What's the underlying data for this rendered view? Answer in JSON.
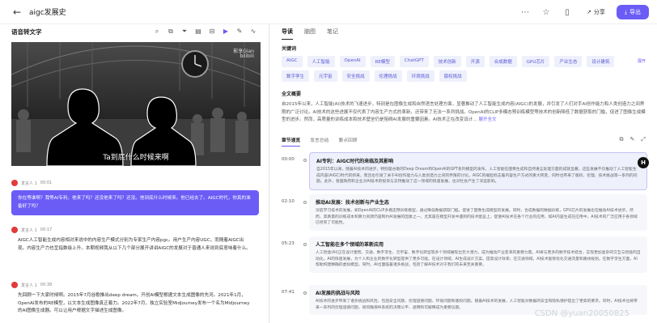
{
  "header": {
    "title": "aigc发展史",
    "share_label": "分享",
    "export_label": "导出"
  },
  "left": {
    "section_label": "语音转文字",
    "tool_icons": [
      "search-icon",
      "copy-icon",
      "filter-icon",
      "doc-icon",
      "collapse-icon",
      "video-icon",
      "edit-icon",
      "waveform-icon"
    ],
    "video": {
      "subtitle": "Ta到底什么时候来啊",
      "watermark_line1": "影享Gian",
      "watermark_line2": "bilibili"
    },
    "messages": [
      {
        "speaker": "发言人 1",
        "time": "00:01",
        "text": "你在等谁啊？我等AI专利。他来了吗？还没他来了吗？还没。他到底什么时候来。他已经去了。AIGC时代，你真的准备好了吗？"
      },
      {
        "speaker": "发言人 1",
        "time": "00:17",
        "text": "AIGC人工智能生成内容相对来说中的内容生产模式分别为专家生产内容pgc。用户生产内容UGC。而随着AIGC出现。内容生产力也呈指数级上升。本期视频我从以下几个部分展开讲讲AIGC的发展对于普通人来说到底意味着什么。"
      },
      {
        "speaker": "发言人 1",
        "time": "00:38",
        "text": "先回顾一下大家时候啊。2015年7月谷歌推出deep dream。开创AI模型根据文本生成图像的先河。2021年1月，OpenAI发布的RE模型，以文本生成图像真正着力。2022年7月，独立实验室Midjourney发布一个名为Midjourney的AI图像生成器。可以让用户根据文字描述生成图像。"
      }
    ]
  },
  "right": {
    "tabs": [
      "导读",
      "脑图",
      "笔记"
    ],
    "keywords_title": "关键词",
    "keywords_more": "展开",
    "keywords": [
      "AIGC",
      "人工智能",
      "OpenAI",
      "RE模型",
      "ChatGPT",
      "技术创新",
      "开源",
      "合成数据",
      "GPU芯片",
      "产业生态",
      "设计建筑",
      "数字孪生",
      "元宇宙",
      "安全挑战",
      "伦理挑战",
      "环境挑战",
      "版权挑战"
    ],
    "summary_title": "全文概要",
    "summary": "自2015年以来，人工智能(AI)技术的飞速进步，特别是在图像生成和自然语言处理方面，显著推动了人工智能生成内容(AIGC)的发展，并引发了人们对手AI创作能力和人类创造力之间界限的广泛讨论。AI技术的这些进展不仅代表了内容生产方式的革新，还带来了无法一系列挑战。OpenAI的CLIP多模态预训练模型等技术的创新降低了数据获取的门槛，促进了图像生成模型的进步。然而，高质量的训练成本和技术壁垒仍是阻碍AI发展的重要因素。AI技术正在改变设计…",
    "summary_more": "展开全文",
    "subtabs": [
      "章节速览",
      "发言总结",
      "要点回顾"
    ],
    "chapters": [
      {
        "time": "00:00",
        "title": "AI专利：AIGC时代的来临及其影响",
        "text": "自2015年以来，随着AI技术的进步，特别是谷歌的Deep Dream和OpenAI的GPT系列模型的发布，人工智能在图像生成和自然语言处理方面的成就显著。这些发展不仅推动了人工智能生成内容(AIGC)时代的到来，而且也引发了关于AI创作能力与人类创造力之间的界限的讨论。AIGC的崛起标志着内容生产方式的重大转变，同时也带来了版权、伦理、技术挑战等一系列的问题。此外，各国政府和企业对AI技术的投资与支持推动了这一领域的快速发展，也对社会产生了深远影响。"
      },
      {
        "time": "02:10",
        "title": "推动AI发展：技术创新与产业生态",
        "text": "深度学习技术的发展，如OpenAI的CLIP多模态预训练模型，通过降低数据获取门槛，促进了图像生成模型的发展。同时，合成数据的数据训练，GPU芯片的发展也在推动AI技术进步。然而，高质量的训练成本和算力资源仍是制约AI发展的因素之一。尤其是在模型开发中遇到的技术壁垒上，促使AI技术在各个行业的应用，如AI内容生成在应用中，AI技术的广泛应用于各领域已经有了可能性。"
      },
      {
        "time": "05:23",
        "title": "人工智能在多个领域的革新应用",
        "text": "人工智能(AI)正在设计建筑、交通、数字孪生、元宇宙、数字化转型等多个领域展现出巨大潜力，成为推动产业变革的重要力量。AI将与更多的数字技术结合，实现更加复杂的交互与智能的自动化。AI的快速发展，为个人和企业的数字化转型提供了更多可能。在设计领域，AI生成设计方案。提高设计效率；在交通领域，AI技术能够优化交通流量和路线规划。在数字孪生方面，AI帮助构建精确的虚拟模型。同时，AI也面临着诸多挑战，包括了解AI技术对于我们的未来至关重要。"
      },
      {
        "time": "07:41",
        "title": "AI发展的挑战与风险",
        "text": "AI技术的进步带来了诸多挑战和风险，包括安全问题、伦理道德问题、环境问题和版权问题。随着AI技术的发展，人工智能对数据的安全和隐私保护提出了更高的要求。同时，AI技术也将带来一系列的伦理道德问题，如何确保AI系统的决策公平、透明和可解释成为重要议题。"
      }
    ],
    "float_badge": "H"
  },
  "watermark": "CSDN @yuan20050825"
}
